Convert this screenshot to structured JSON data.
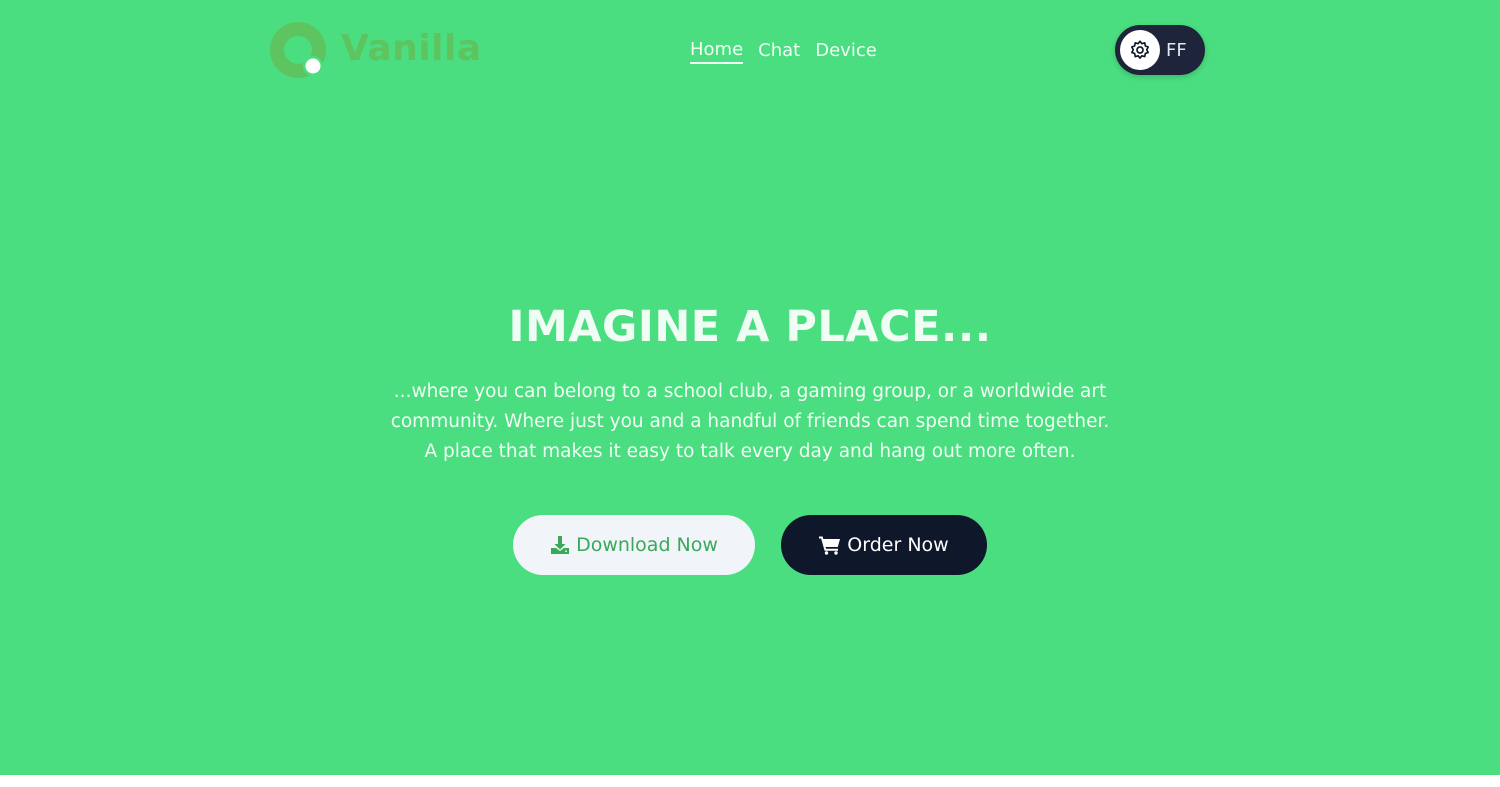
{
  "brand": {
    "name": "Vanilla",
    "logo_icon": "vanilla-logo-icon",
    "color": "#5ec45f"
  },
  "nav": {
    "items": [
      {
        "label": "Home",
        "active": true
      },
      {
        "label": "Chat",
        "active": false
      },
      {
        "label": "Device",
        "active": false
      }
    ]
  },
  "user": {
    "initials": "FF",
    "settings_icon": "gear-icon"
  },
  "hero": {
    "background": "#4ade80",
    "title": "IMAGINE A PLACE...",
    "subtitle": "...where you can belong to a school club, a gaming group, or a worldwide art community. Where just you and a handful of friends can spend time together. A place that makes it easy to talk every day and hang out more often.",
    "download_label": "Download Now",
    "download_icon": "download-icon",
    "order_label": "Order Now",
    "order_icon": "cart-icon"
  }
}
